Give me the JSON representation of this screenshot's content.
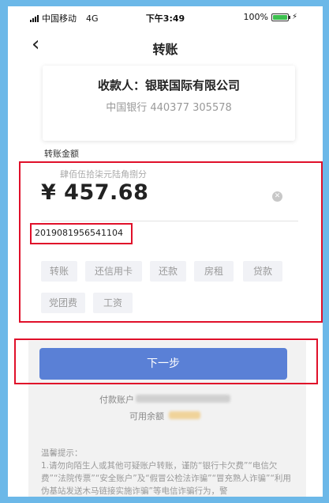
{
  "status_bar": {
    "carrier": "中国移动",
    "network": "4G",
    "time": "下午3:49",
    "battery": "100%",
    "battery_level": 1.0
  },
  "nav": {
    "back_icon": "chevron-left-icon",
    "title": "转账"
  },
  "payee": {
    "name": "收款人：银联国际有限公司",
    "account": "中国银行 440377 305578"
  },
  "amount": {
    "label": "转账金额",
    "in_words": "肆佰伍拾柒元陆角捌分",
    "value": "¥ 457.68",
    "clear_icon": "clear-icon"
  },
  "reference": "2019081956541104",
  "quick_chips": [
    "转账",
    "还信用卡",
    "还款",
    "房租",
    "贷款",
    "党团费",
    "工资"
  ],
  "next_button": "下一步",
  "payer": {
    "account_label": "付款账户",
    "balance_label": "可用余额"
  },
  "tips": {
    "heading": "温馨提示：",
    "body": "1.请勿向陌生人或其他可疑账户转账，谨防“银行卡欠费”“电信欠费”“法院传票”“安全账户”及“假冒公检法诈骗”“冒充熟人诈骗”“利用伪基站发送木马链接实施诈骗”等电信诈骗行为，警"
  },
  "colors": {
    "accent": "#5a80d6",
    "highlight": "#e0102a",
    "frame": "#6cb8e8"
  }
}
